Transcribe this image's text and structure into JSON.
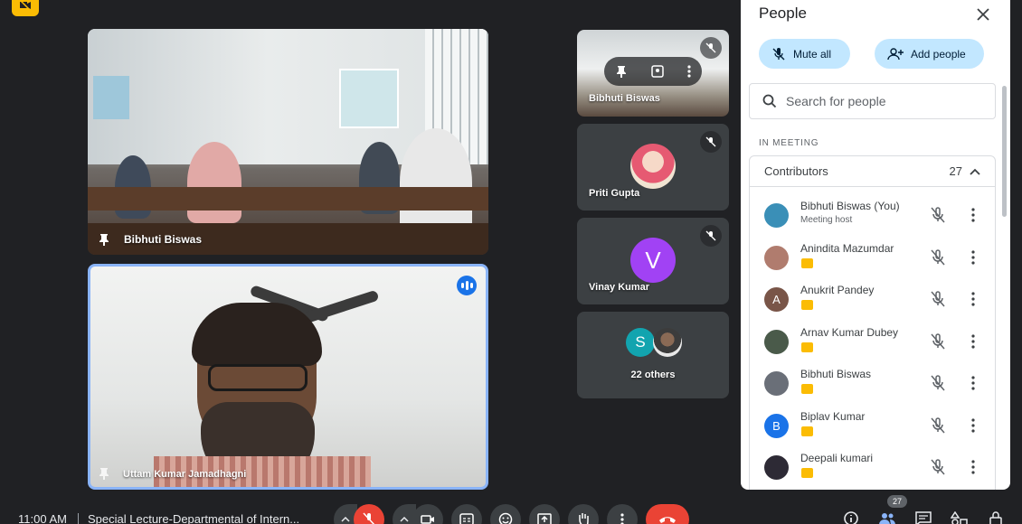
{
  "main_tiles": [
    {
      "name": "Bibhuti Biswas"
    },
    {
      "name": "Uttam Kumar Jamadhagni"
    }
  ],
  "side_tiles": [
    {
      "name": "Bibhuti Biswas"
    },
    {
      "name": "Priti Gupta"
    },
    {
      "name": "Vinay Kumar",
      "initial": "V",
      "color": "#a142f4"
    },
    {
      "others_label": "22 others",
      "initial": "S",
      "color": "#12a4af"
    }
  ],
  "people_panel": {
    "title": "People",
    "mute_all_label": "Mute all",
    "add_people_label": "Add people",
    "search_placeholder": "Search for people",
    "section_label": "IN MEETING",
    "group_label": "Contributors",
    "group_count": "27",
    "participants": [
      {
        "name": "Bibhuti Biswas (You)",
        "sub": "Meeting host",
        "avatar_color": "#3a8fb7"
      },
      {
        "name": "Anindita Mazumdar",
        "avatar_color": "#b07c6e"
      },
      {
        "name": "Anukrit Pandey",
        "initial": "A",
        "avatar_color": "#795548"
      },
      {
        "name": "Arnav Kumar Dubey",
        "avatar_color": "#4a5a4a"
      },
      {
        "name": "Bibhuti Biswas",
        "avatar_color": "#6a6f78"
      },
      {
        "name": "Biplav Kumar",
        "initial": "B",
        "avatar_color": "#1a73e8"
      },
      {
        "name": "Deepali kumari",
        "avatar_color": "#2d2a35"
      }
    ]
  },
  "bottom_bar": {
    "time": "11:00 AM",
    "meeting_title": "Special Lecture-Departmental of Intern...",
    "people_count": "27"
  }
}
